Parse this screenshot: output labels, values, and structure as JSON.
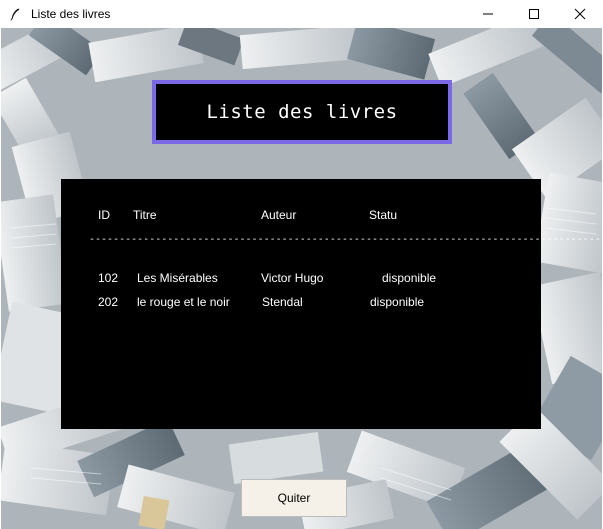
{
  "window": {
    "title": "Liste des livres"
  },
  "banner": {
    "title": "Liste des livres"
  },
  "table": {
    "headers": [
      "ID",
      "Titre",
      "Auteur",
      "Statu"
    ],
    "separator": "--------------------------------------------------------------------------------------",
    "rows": [
      [
        "102",
        "Les Misérables",
        "Victor Hugo",
        "disponible"
      ],
      [
        "202",
        "le rouge et le noir",
        "Stendal",
        "disponible"
      ]
    ]
  },
  "buttons": {
    "quit_label": "Quiter"
  },
  "colors": {
    "banner_border": "#7b68e6",
    "panel_bg": "#000000",
    "quit_bg": "#f5f1e8"
  },
  "icons": {
    "app": "feather-icon",
    "minimize": "minimize-icon",
    "maximize": "maximize-icon",
    "close": "close-icon"
  }
}
